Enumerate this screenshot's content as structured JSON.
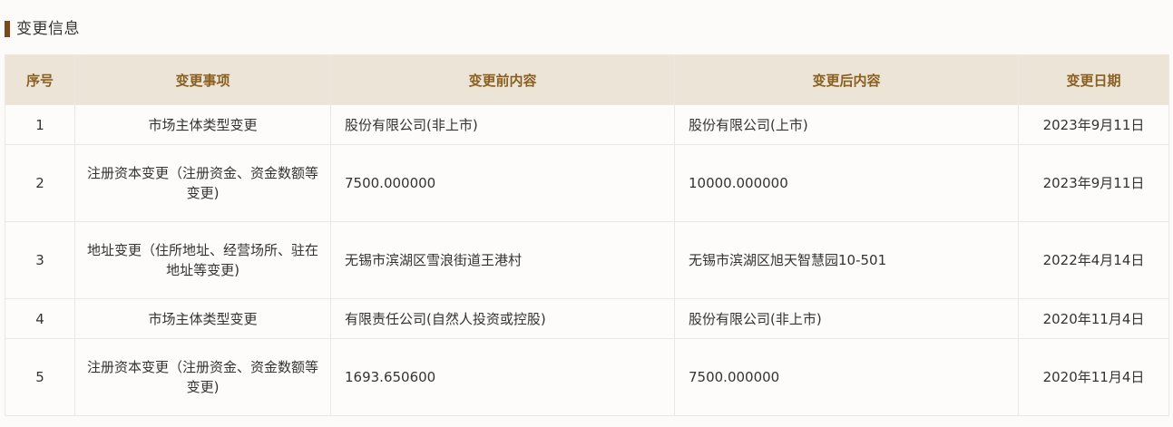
{
  "section": {
    "title": "变更信息"
  },
  "table": {
    "headers": {
      "index": "序号",
      "item": "变更事项",
      "before": "变更前内容",
      "after": "变更后内容",
      "date": "变更日期"
    },
    "rows": [
      {
        "index": "1",
        "item": "市场主体类型变更",
        "before": "股份有限公司(非上市)",
        "after": "股份有限公司(上市)",
        "date": "2023年9月11日"
      },
      {
        "index": "2",
        "item": "注册资本变更（注册资金、资金数额等变更)",
        "before": "7500.000000",
        "after": "10000.000000",
        "date": "2023年9月11日"
      },
      {
        "index": "3",
        "item": "地址变更（住所地址、经营场所、驻在地址等变更)",
        "before": "无锡市滨湖区雪浪街道王港村",
        "after": "无锡市滨湖区旭天智慧园10-501",
        "date": "2022年4月14日"
      },
      {
        "index": "4",
        "item": "市场主体类型变更",
        "before": "有限责任公司(自然人投资或控股)",
        "after": "股份有限公司(非上市)",
        "date": "2020年11月4日"
      },
      {
        "index": "5",
        "item": "注册资本变更（注册资金、资金数额等变更)",
        "before": "1693.650600",
        "after": "7500.000000",
        "date": "2020年11月4日"
      }
    ]
  }
}
